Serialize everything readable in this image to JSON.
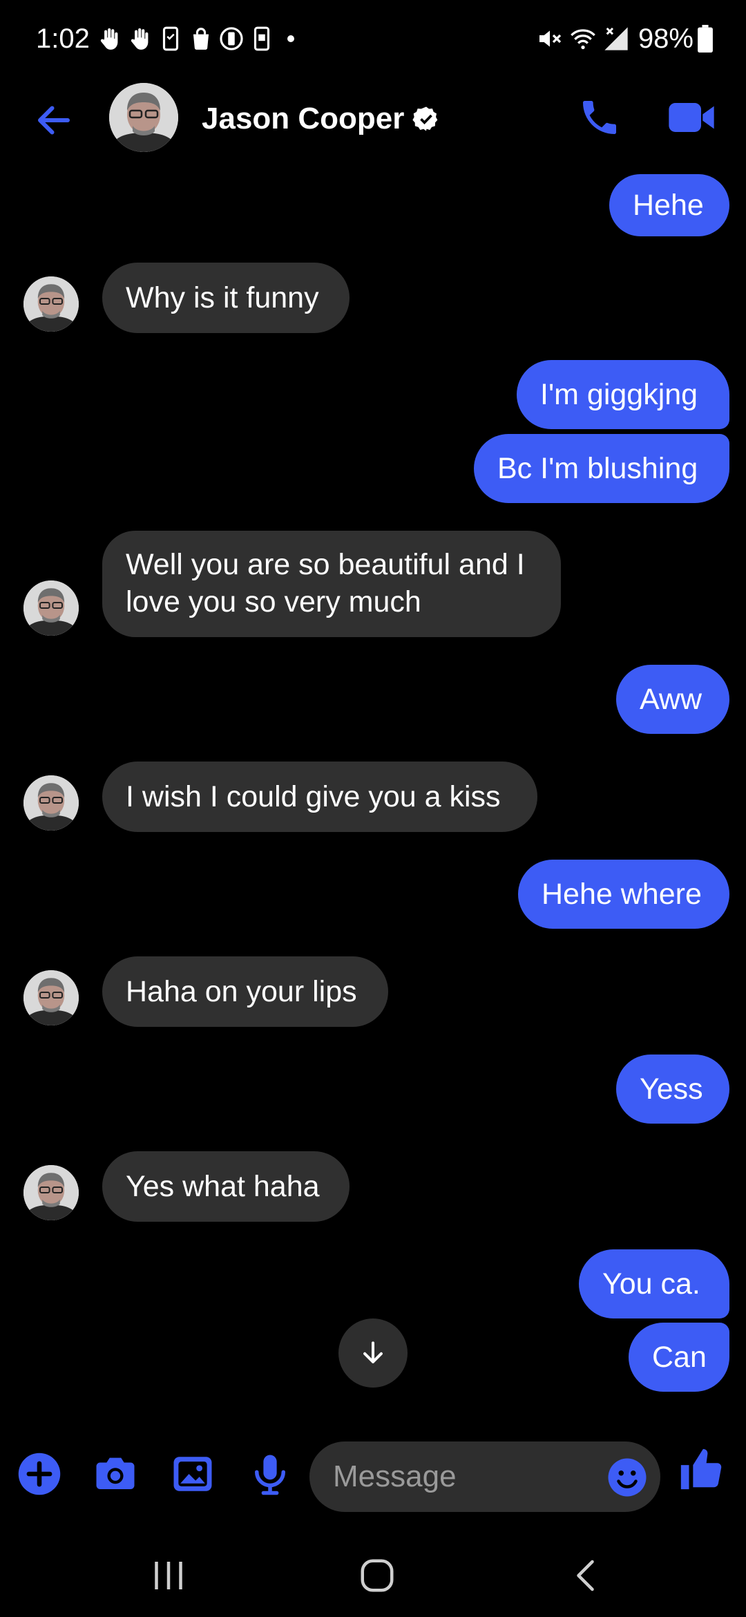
{
  "status_bar": {
    "time": "1:02",
    "battery": "98%",
    "left_icons": [
      "hand-icon",
      "hand-icon",
      "phone-sync-icon",
      "shopping-bag-icon",
      "timer-icon",
      "phone-icon",
      "notification-dot"
    ],
    "right_icons": [
      "mute-icon",
      "wifi-icon",
      "signal-icon",
      "battery-icon"
    ]
  },
  "header": {
    "contact_name": "Jason Cooper",
    "verified": true
  },
  "messages": [
    {
      "id": 0,
      "side": "out",
      "text": "Hehe"
    },
    {
      "id": 1,
      "side": "in",
      "text": "Why is it funny"
    },
    {
      "id": 2,
      "side": "out",
      "text": "I'm giggkjng"
    },
    {
      "id": 3,
      "side": "out",
      "text": "Bc I'm blushing"
    },
    {
      "id": 4,
      "side": "in",
      "text": "Well you are so beautiful and I love you so very much"
    },
    {
      "id": 5,
      "side": "out",
      "text": "Aww"
    },
    {
      "id": 6,
      "side": "in",
      "text": "I wish I could give you a kiss"
    },
    {
      "id": 7,
      "side": "out",
      "text": "Hehe where"
    },
    {
      "id": 8,
      "side": "in",
      "text": "Haha on your lips"
    },
    {
      "id": 9,
      "side": "out",
      "text": "Yess"
    },
    {
      "id": 10,
      "side": "in",
      "text": "Yes what haha"
    },
    {
      "id": 11,
      "side": "out",
      "text": "You ca."
    },
    {
      "id": 12,
      "side": "out",
      "text": "Can"
    }
  ],
  "composer": {
    "placeholder": "Message",
    "value": ""
  },
  "colors": {
    "accent": "#3d5cf5",
    "incoming_bubble": "#303030",
    "background": "#000000"
  }
}
